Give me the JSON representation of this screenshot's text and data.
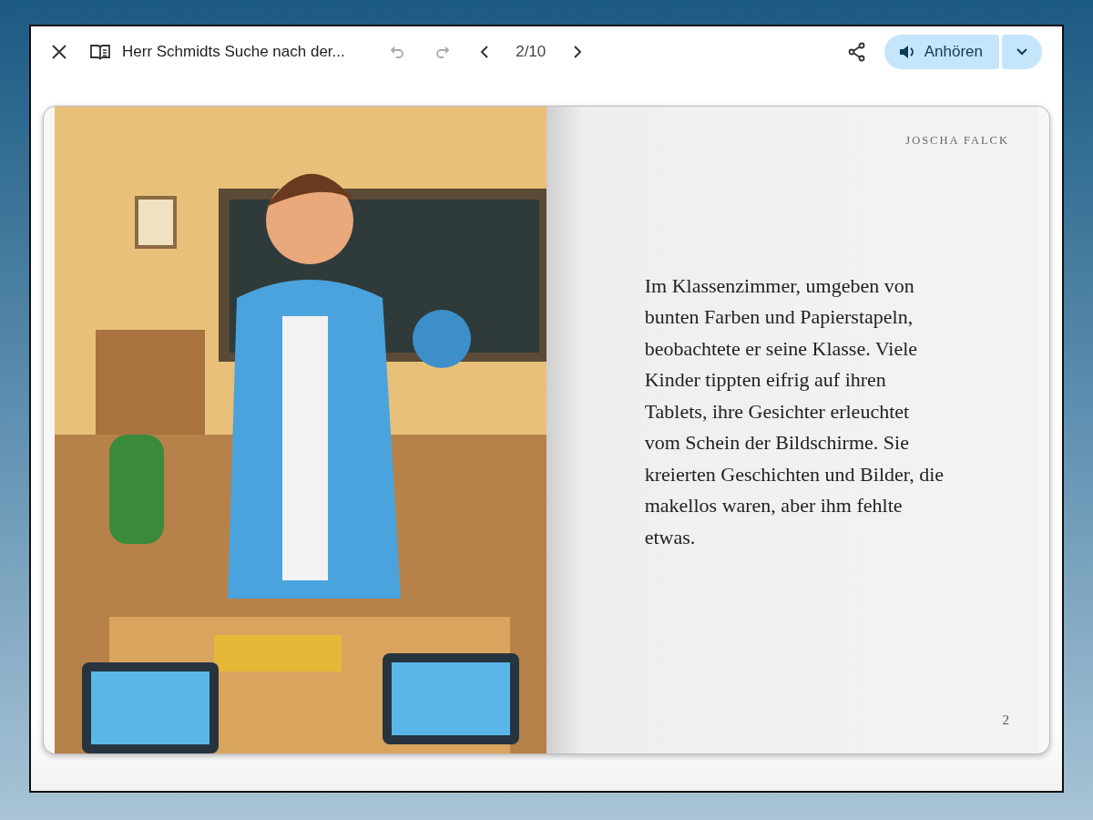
{
  "toolbar": {
    "title": "Herr Schmidts Suche nach der...",
    "undo": {
      "disabled": true
    },
    "redo": {
      "disabled": true
    },
    "page_indicator": "2/10",
    "listen_button": "Anhören"
  },
  "book": {
    "right_page": {
      "author": "JOSCHA FALCK",
      "text": "Im Klassenzimmer, umgeben von bunten Farben und Papierstapeln, beobachtete er seine Klasse. Viele Kinder tippten eifrig auf ihren Tablets, ihre Gesichter erleuchtet vom Schein der Bildschirme. Sie kreierten Geschichten und Bilder, die makellos waren, aber ihm fehlte etwas.",
      "page_number": "2"
    }
  }
}
